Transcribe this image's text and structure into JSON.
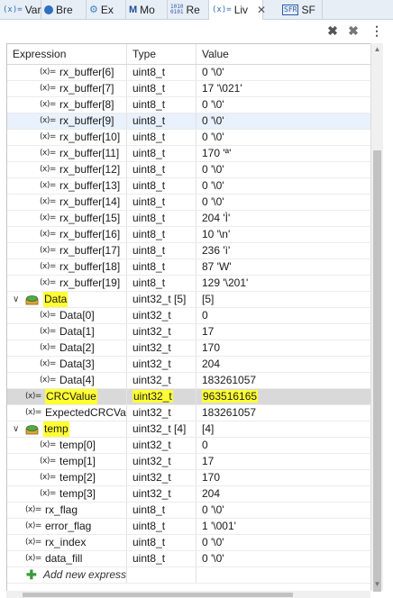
{
  "tabs": [
    {
      "label": "Var",
      "icon": "variables-icon"
    },
    {
      "label": "Bre",
      "icon": "breakpoints-icon"
    },
    {
      "label": "Ex",
      "icon": "expressions-icon"
    },
    {
      "label": "Mo",
      "icon": "memory-icon"
    },
    {
      "label": "Re",
      "icon": "registers-icon"
    },
    {
      "label": "Liv",
      "icon": "live-expressions-icon",
      "active": true,
      "close": "✕"
    },
    {
      "label": "SF",
      "icon": "sfr-icon"
    }
  ],
  "toolbar": {
    "remove_label": "✖",
    "remove_all_label": "✖",
    "menu_label": "⋮"
  },
  "table": {
    "headers": [
      "Expression",
      "Type",
      "Value"
    ],
    "rows": [
      {
        "name": "rx_buffer[6]",
        "type": "uint8_t",
        "value": "0 '\\0'",
        "level": 1
      },
      {
        "name": "rx_buffer[7]",
        "type": "uint8_t",
        "value": "17 '\\021'",
        "level": 1
      },
      {
        "name": "rx_buffer[8]",
        "type": "uint8_t",
        "value": "0 '\\0'",
        "level": 1
      },
      {
        "name": "rx_buffer[9]",
        "type": "uint8_t",
        "value": "0 '\\0'",
        "level": 1,
        "selected": true
      },
      {
        "name": "rx_buffer[10]",
        "type": "uint8_t",
        "value": "0 '\\0'",
        "level": 1
      },
      {
        "name": "rx_buffer[11]",
        "type": "uint8_t",
        "value": "170 'ª'",
        "level": 1
      },
      {
        "name": "rx_buffer[12]",
        "type": "uint8_t",
        "value": "0 '\\0'",
        "level": 1
      },
      {
        "name": "rx_buffer[13]",
        "type": "uint8_t",
        "value": "0 '\\0'",
        "level": 1
      },
      {
        "name": "rx_buffer[14]",
        "type": "uint8_t",
        "value": "0 '\\0'",
        "level": 1
      },
      {
        "name": "rx_buffer[15]",
        "type": "uint8_t",
        "value": "204 'Ì'",
        "level": 1
      },
      {
        "name": "rx_buffer[16]",
        "type": "uint8_t",
        "value": "10 '\\n'",
        "level": 1
      },
      {
        "name": "rx_buffer[17]",
        "type": "uint8_t",
        "value": "236 'ì'",
        "level": 1
      },
      {
        "name": "rx_buffer[18]",
        "type": "uint8_t",
        "value": "87 'W'",
        "level": 1
      },
      {
        "name": "rx_buffer[19]",
        "type": "uint8_t",
        "value": "129 '\\201'",
        "level": 1
      },
      {
        "name": "Data",
        "type": "uint32_t [5]",
        "value": "[5]",
        "level": 0,
        "group": true,
        "highlight_name": true
      },
      {
        "name": "Data[0]",
        "type": "uint32_t",
        "value": "0",
        "level": 1
      },
      {
        "name": "Data[1]",
        "type": "uint32_t",
        "value": "17",
        "level": 1
      },
      {
        "name": "Data[2]",
        "type": "uint32_t",
        "value": "170",
        "level": 1
      },
      {
        "name": "Data[3]",
        "type": "uint32_t",
        "value": "204",
        "level": 1
      },
      {
        "name": "Data[4]",
        "type": "uint32_t",
        "value": "183261057",
        "level": 1
      },
      {
        "name": "CRCValue",
        "type": "uint32_t",
        "value": "963516165",
        "level": 0,
        "grey": true,
        "highlight_all": true
      },
      {
        "name": "ExpectedCRCValu",
        "type": "uint32_t",
        "value": "183261057",
        "level": 0
      },
      {
        "name": "temp",
        "type": "uint32_t [4]",
        "value": "[4]",
        "level": 0,
        "group": true,
        "highlight_name": true
      },
      {
        "name": "temp[0]",
        "type": "uint32_t",
        "value": "0",
        "level": 1
      },
      {
        "name": "temp[1]",
        "type": "uint32_t",
        "value": "17",
        "level": 1
      },
      {
        "name": "temp[2]",
        "type": "uint32_t",
        "value": "170",
        "level": 1
      },
      {
        "name": "temp[3]",
        "type": "uint32_t",
        "value": "204",
        "level": 1
      },
      {
        "name": "rx_flag",
        "type": "uint8_t",
        "value": "0 '\\0'",
        "level": 0
      },
      {
        "name": "error_flag",
        "type": "uint8_t",
        "value": "1 '\\001'",
        "level": 0
      },
      {
        "name": "rx_index",
        "type": "uint8_t",
        "value": "0 '\\0'",
        "level": 0
      },
      {
        "name": "data_fill",
        "type": "uint8_t",
        "value": "0 '\\0'",
        "level": 0
      }
    ],
    "add_row_label": "Add new expressi",
    "expression_icon_text": "(x)="
  },
  "colors": {
    "highlight": "#ffff33",
    "selected_row": "#e8f1fc",
    "grey_row": "#d9d9d9"
  }
}
